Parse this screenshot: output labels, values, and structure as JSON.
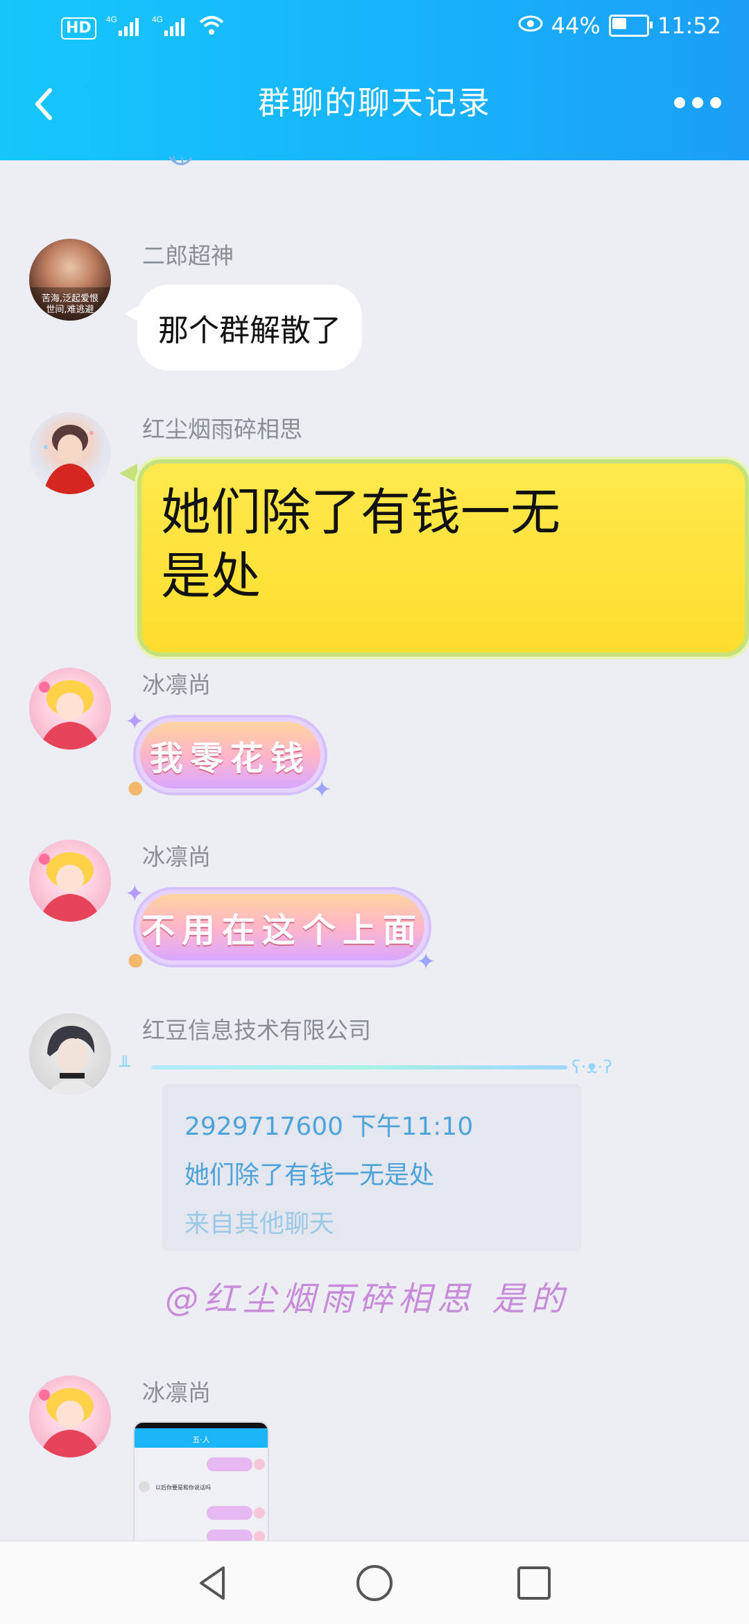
{
  "status_bar": {
    "hd": "HD",
    "sim1": "4G",
    "sim2": "4G",
    "battery_percent": "44%",
    "time": "11:52"
  },
  "header": {
    "title": "群聊的聊天记录"
  },
  "messages": [
    {
      "sender": "二郎超神",
      "text": "那个群解散了",
      "avatar_caption_1": "苦海,泛起爱恨",
      "avatar_caption_2": "世间,难逃避"
    },
    {
      "sender": "红尘烟雨碎相思",
      "text_line1": "她们除了有钱一无",
      "text_line2": "是处"
    },
    {
      "sender": "冰凛尚",
      "sticker_text": "我零花钱"
    },
    {
      "sender": "冰凛尚",
      "sticker_text": "不用在这个上面"
    },
    {
      "sender": "红豆信息技术有限公司",
      "quote": {
        "header": "2929717600 下午11:10",
        "text": "她们除了有钱一无是处",
        "source": "来自其他聊天"
      },
      "mention_text": "@红尘烟雨碎相思 是的",
      "kaomoji": "ʕ·ᴥ·ʔ"
    },
    {
      "sender": "冰凛尚",
      "screenshot_title": "五·人"
    }
  ],
  "screenshot_preview": {
    "row_text": "以后你要是和你说话吗"
  }
}
